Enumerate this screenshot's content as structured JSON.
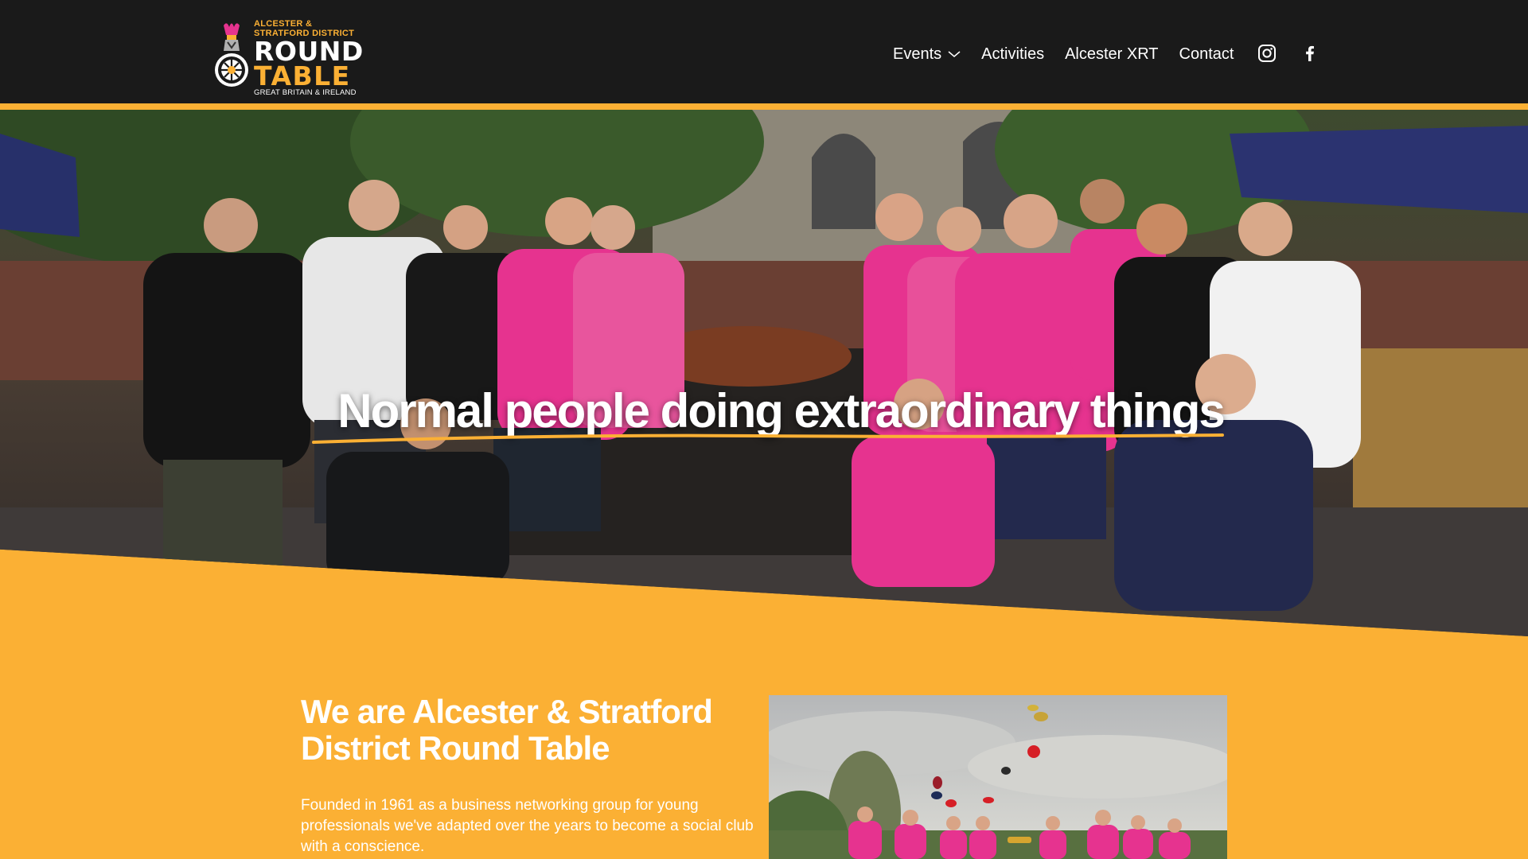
{
  "logo": {
    "line1": "ALCESTER &",
    "line2": "STRATFORD DISTRICT",
    "round": "ROUND",
    "table": "TABLE",
    "sub": "GREAT BRITAIN & IRELAND"
  },
  "nav": {
    "items": [
      {
        "label": "Events",
        "has_dropdown": true,
        "icon": "chevron-down-icon"
      },
      {
        "label": "Activities"
      },
      {
        "label": "Alcester XRT"
      },
      {
        "label": "Contact"
      }
    ],
    "social": [
      {
        "icon": "instagram-icon"
      },
      {
        "icon": "facebook-icon"
      }
    ]
  },
  "hero": {
    "title": "Normal people doing extraordinary things"
  },
  "intro": {
    "title": "We are Alcester & Stratford District Round Table",
    "text": "Founded in 1961 as a business networking group for young professionals we've adapted over the years to become a social club with a conscience."
  },
  "colors": {
    "accent": "#fbb034",
    "header_bg": "#1a1a1a",
    "text": "#ffffff",
    "shirt_pink": "#e6338f",
    "navy": "#23294d"
  }
}
